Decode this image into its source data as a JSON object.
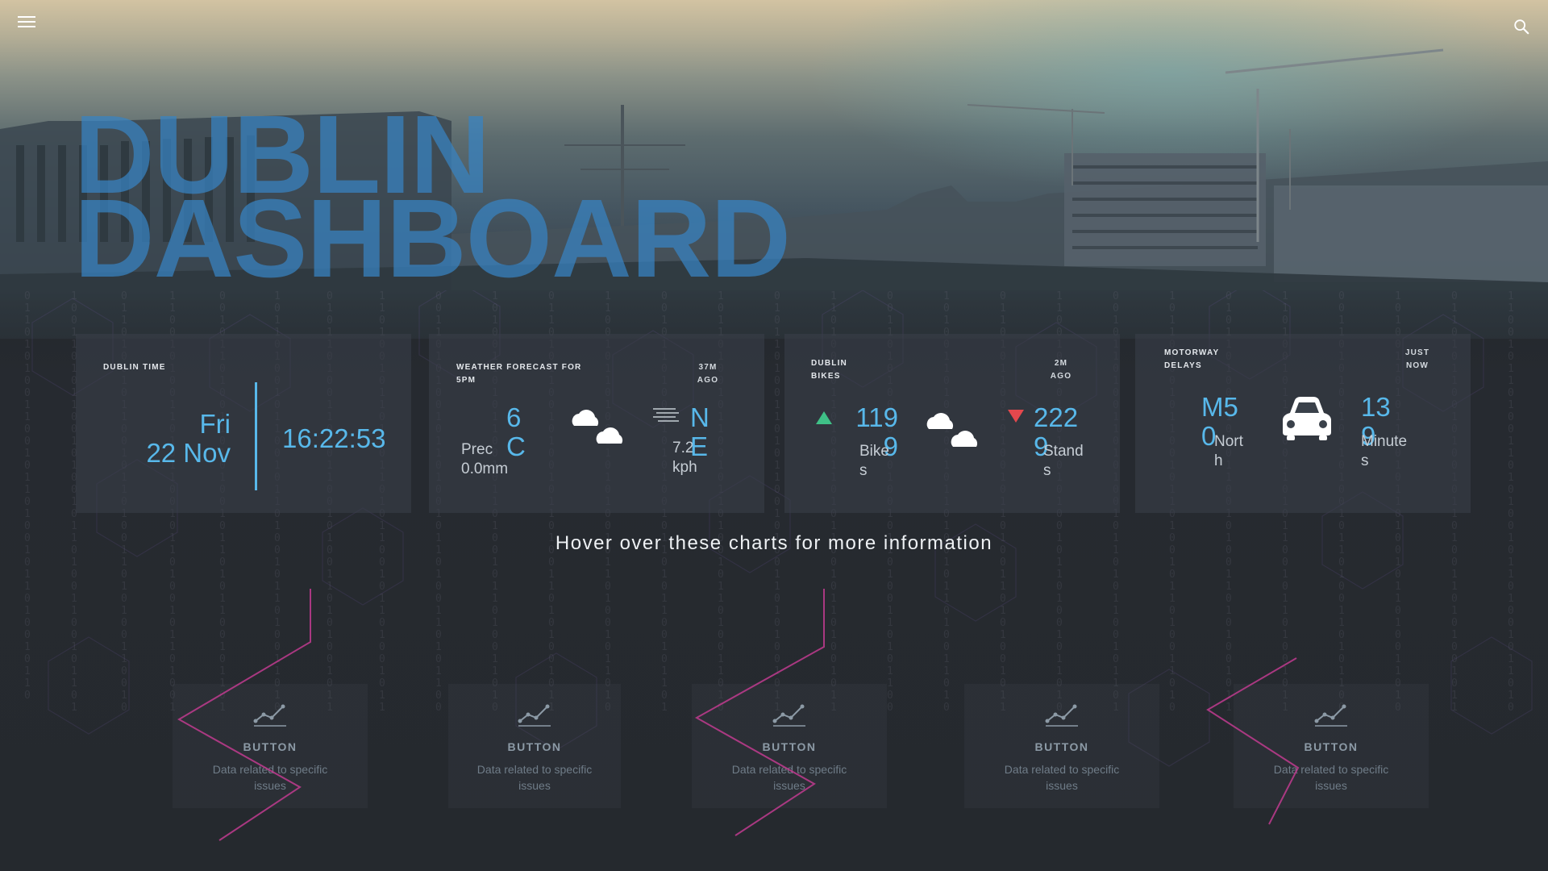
{
  "header": {
    "menu_icon": "hamburger-menu-icon",
    "search_icon": "search-icon"
  },
  "hero": {
    "title_line1": "DUBLIN",
    "title_line2": "DASHBOARD"
  },
  "cards": {
    "time": {
      "label": "DUBLIN TIME",
      "day": "Fri",
      "date": "22 Nov",
      "clock": "16:22:53"
    },
    "weather": {
      "label_line1": "WEATHER FORECAST FOR",
      "label_line2": "5PM",
      "updated_line1": "37M",
      "updated_line2": "AGO",
      "temp_line1": "6",
      "temp_line2": "C",
      "precip_label": "Prec",
      "precip_value": "0.0mm",
      "icon": "cloud-icon",
      "wind_icon": "wind-icon",
      "wind_dir_line1": "N",
      "wind_dir_line2": "E",
      "wind_speed_line1": "7.2",
      "wind_speed_line2": "kph"
    },
    "bikes": {
      "label_line1": "DUBLIN",
      "label_line2": "BIKES",
      "updated_line1": "2M",
      "updated_line2": "AGO",
      "bikes_icon": "triangle-up-icon",
      "bikes_value_line1": "119",
      "bikes_value_line2": "9",
      "bikes_unit_line1": "Bike",
      "bikes_unit_line2": "s",
      "weather_icon": "cloud-icon",
      "stands_icon": "triangle-down-icon",
      "stands_value_line1": "222",
      "stands_value_line2": "9",
      "stands_unit_line1": "Stand",
      "stands_unit_line2": "s"
    },
    "motorway": {
      "label_line1": "MOTORWAY",
      "label_line2": "DELAYS",
      "updated_line1": "JUST",
      "updated_line2": "NOW",
      "road_line1": "M5",
      "road_line2": "0",
      "direction_line1": "Nort",
      "direction_line2": "h",
      "car_icon": "car-icon",
      "delay_line1": "13",
      "delay_line2": "9",
      "delay_unit_line1": "Minute",
      "delay_unit_line2": "s"
    }
  },
  "caption": "Hover over these charts for more information",
  "issue_buttons": [
    {
      "icon": "line-chart-icon",
      "label": "BUTTON",
      "desc_line1": "Data related to specific",
      "desc_line2": "issues"
    },
    {
      "icon": "line-chart-icon",
      "label": "BUTTON",
      "desc_line1": "Data related to specific",
      "desc_line2": "issues"
    },
    {
      "icon": "line-chart-icon",
      "label": "BUTTON",
      "desc_line1": "Data related to specific",
      "desc_line2": "issues"
    },
    {
      "icon": "line-chart-icon",
      "label": "BUTTON",
      "desc_line1": "Data related to specific",
      "desc_line2": "issues"
    },
    {
      "icon": "line-chart-icon",
      "label": "BUTTON",
      "desc_line1": "Data related to specific",
      "desc_line2": "issues"
    }
  ],
  "colors": {
    "accent": "#58b8ea",
    "title": "#3884c4",
    "up": "#3fc187",
    "down": "#e5484d",
    "chevron": "#c13b8f"
  }
}
